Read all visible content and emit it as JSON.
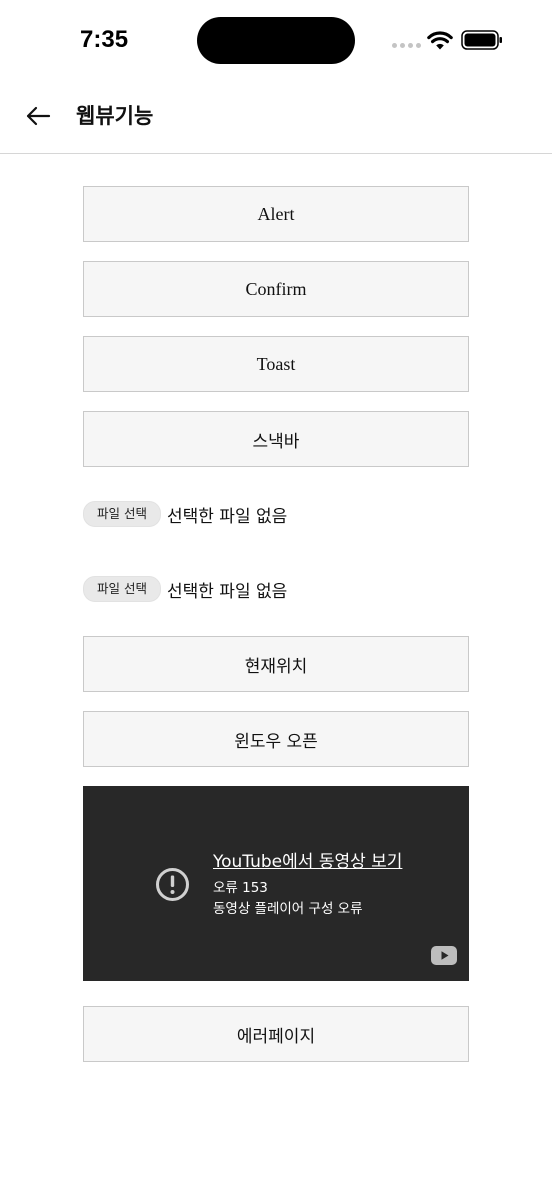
{
  "status_bar": {
    "time": "7:35"
  },
  "header": {
    "title": "웹뷰기능",
    "back_icon": "arrow-left-icon"
  },
  "buttons": {
    "alert": "Alert",
    "confirm": "Confirm",
    "toast": "Toast",
    "snackbar": "스낵바",
    "current_location": "현재위치",
    "window_open": "윈도우 오픈",
    "error_page": "에러페이지"
  },
  "file_inputs": [
    {
      "button_label": "파일 선택",
      "status": "선택한 파일 없음"
    },
    {
      "button_label": "파일 선택",
      "status": "선택한 파일 없음"
    }
  ],
  "video": {
    "link_text": "YouTube에서 동영상 보기",
    "error_code": "오류 153",
    "error_message": "동영상 플레이어 구성 오류",
    "background_color": "#282828"
  }
}
